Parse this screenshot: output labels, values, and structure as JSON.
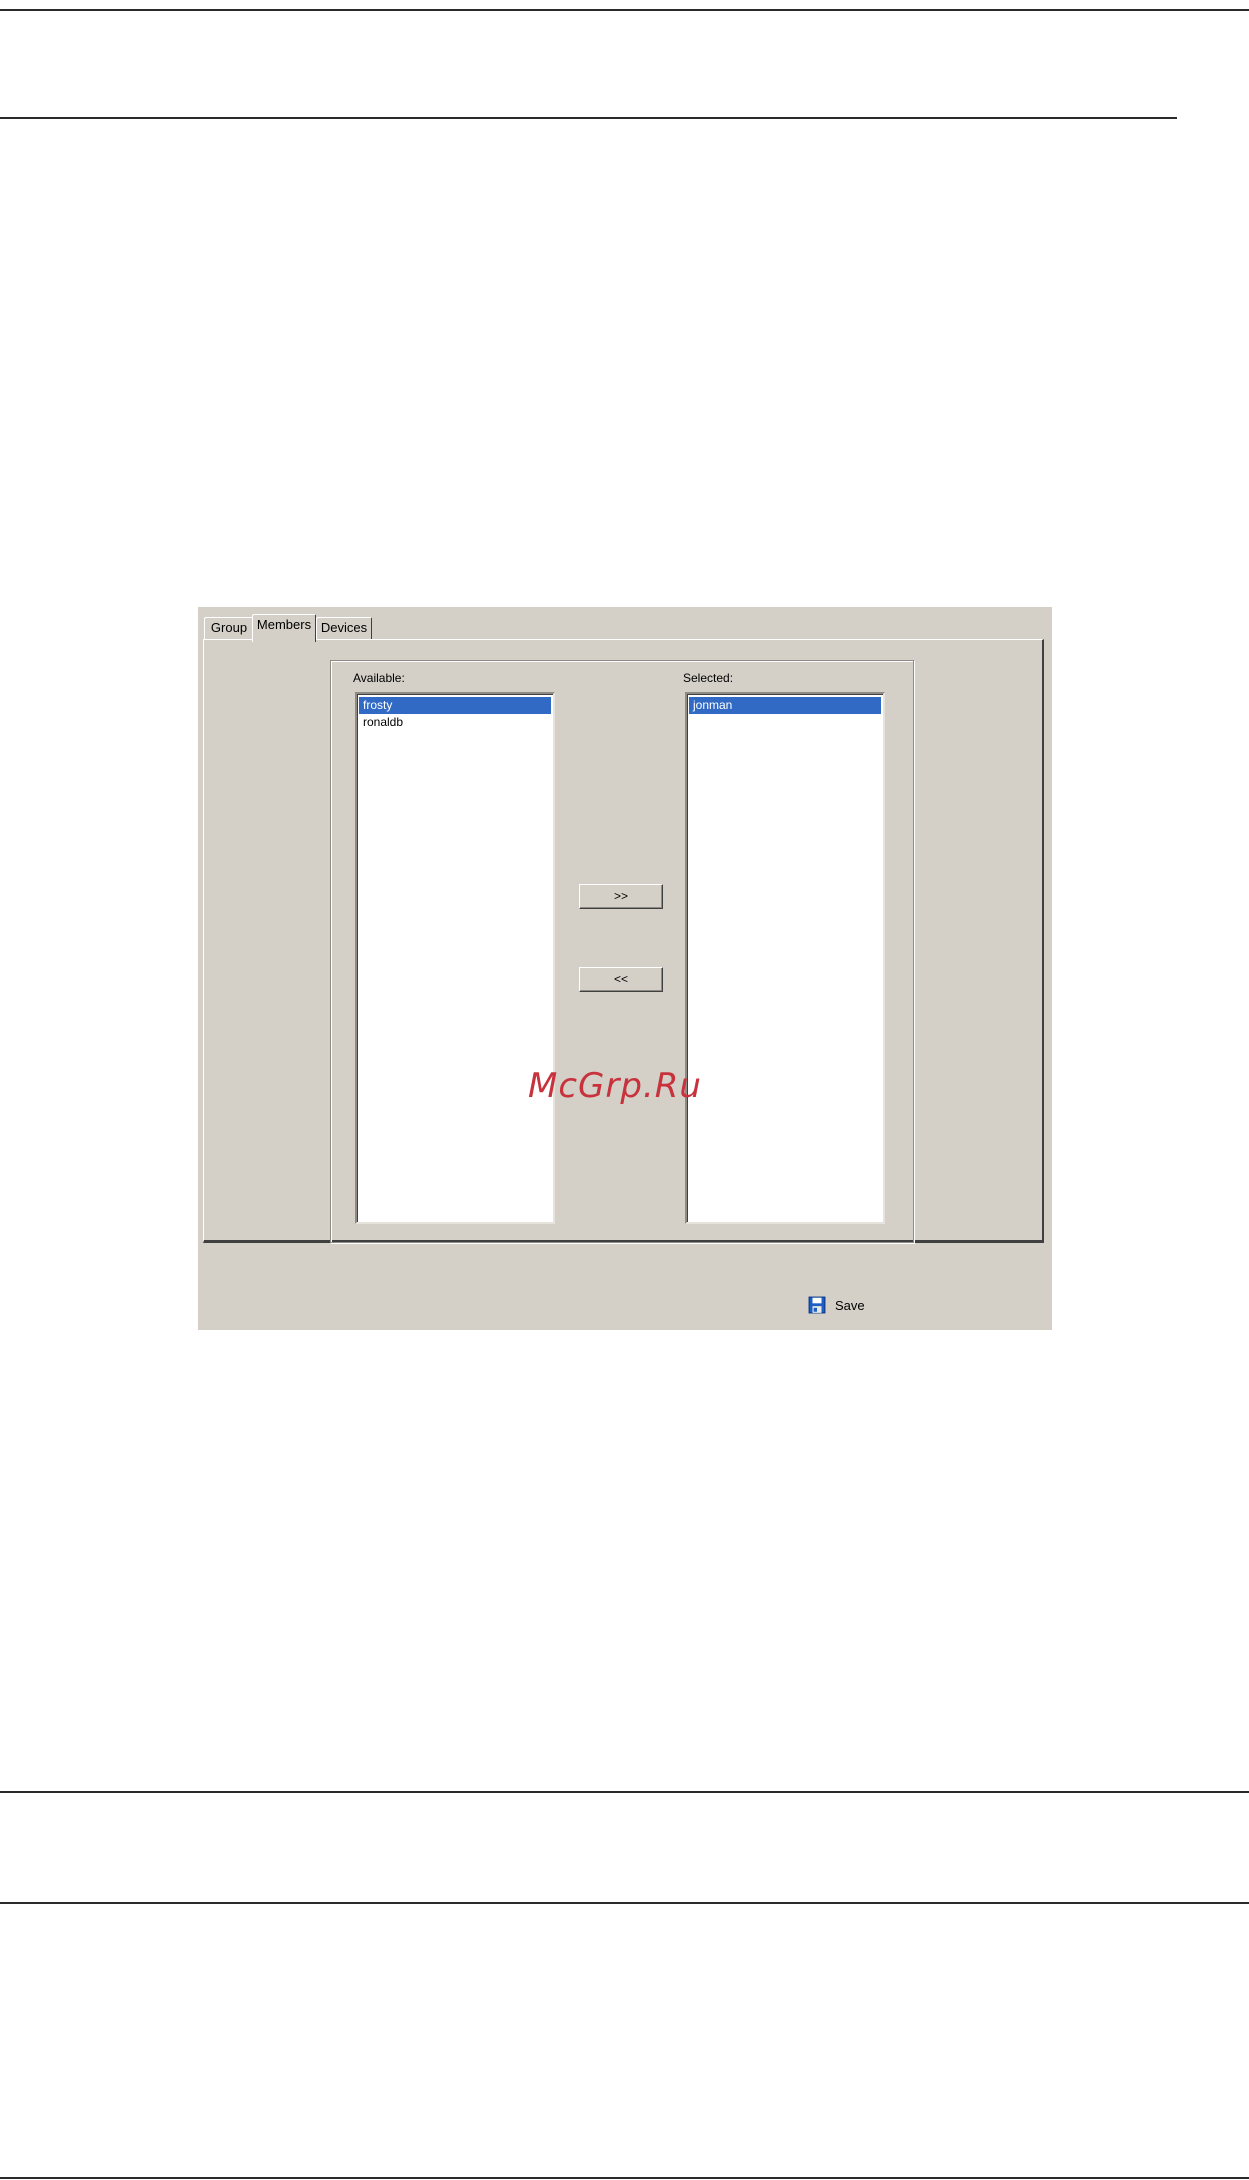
{
  "dialog": {
    "tabs": [
      {
        "label": "Group"
      },
      {
        "label": "Members"
      },
      {
        "label": "Devices"
      }
    ],
    "active_tab": "Members",
    "available": {
      "label": "Available:",
      "items": [
        "frosty",
        "ronaldb"
      ],
      "selected_index": 0
    },
    "selected": {
      "label": "Selected:",
      "items": [
        "jonman"
      ],
      "selected_index": 0
    },
    "add_button_label": ">>",
    "remove_button_label": "<<",
    "save_label": "Save"
  },
  "watermark": "McGrp.Ru",
  "colors": {
    "dialog_background": "#d4d0c8",
    "selection": "#316ac5",
    "watermark": "#c8323c"
  },
  "icons": {
    "save": "floppy-disk-icon"
  }
}
